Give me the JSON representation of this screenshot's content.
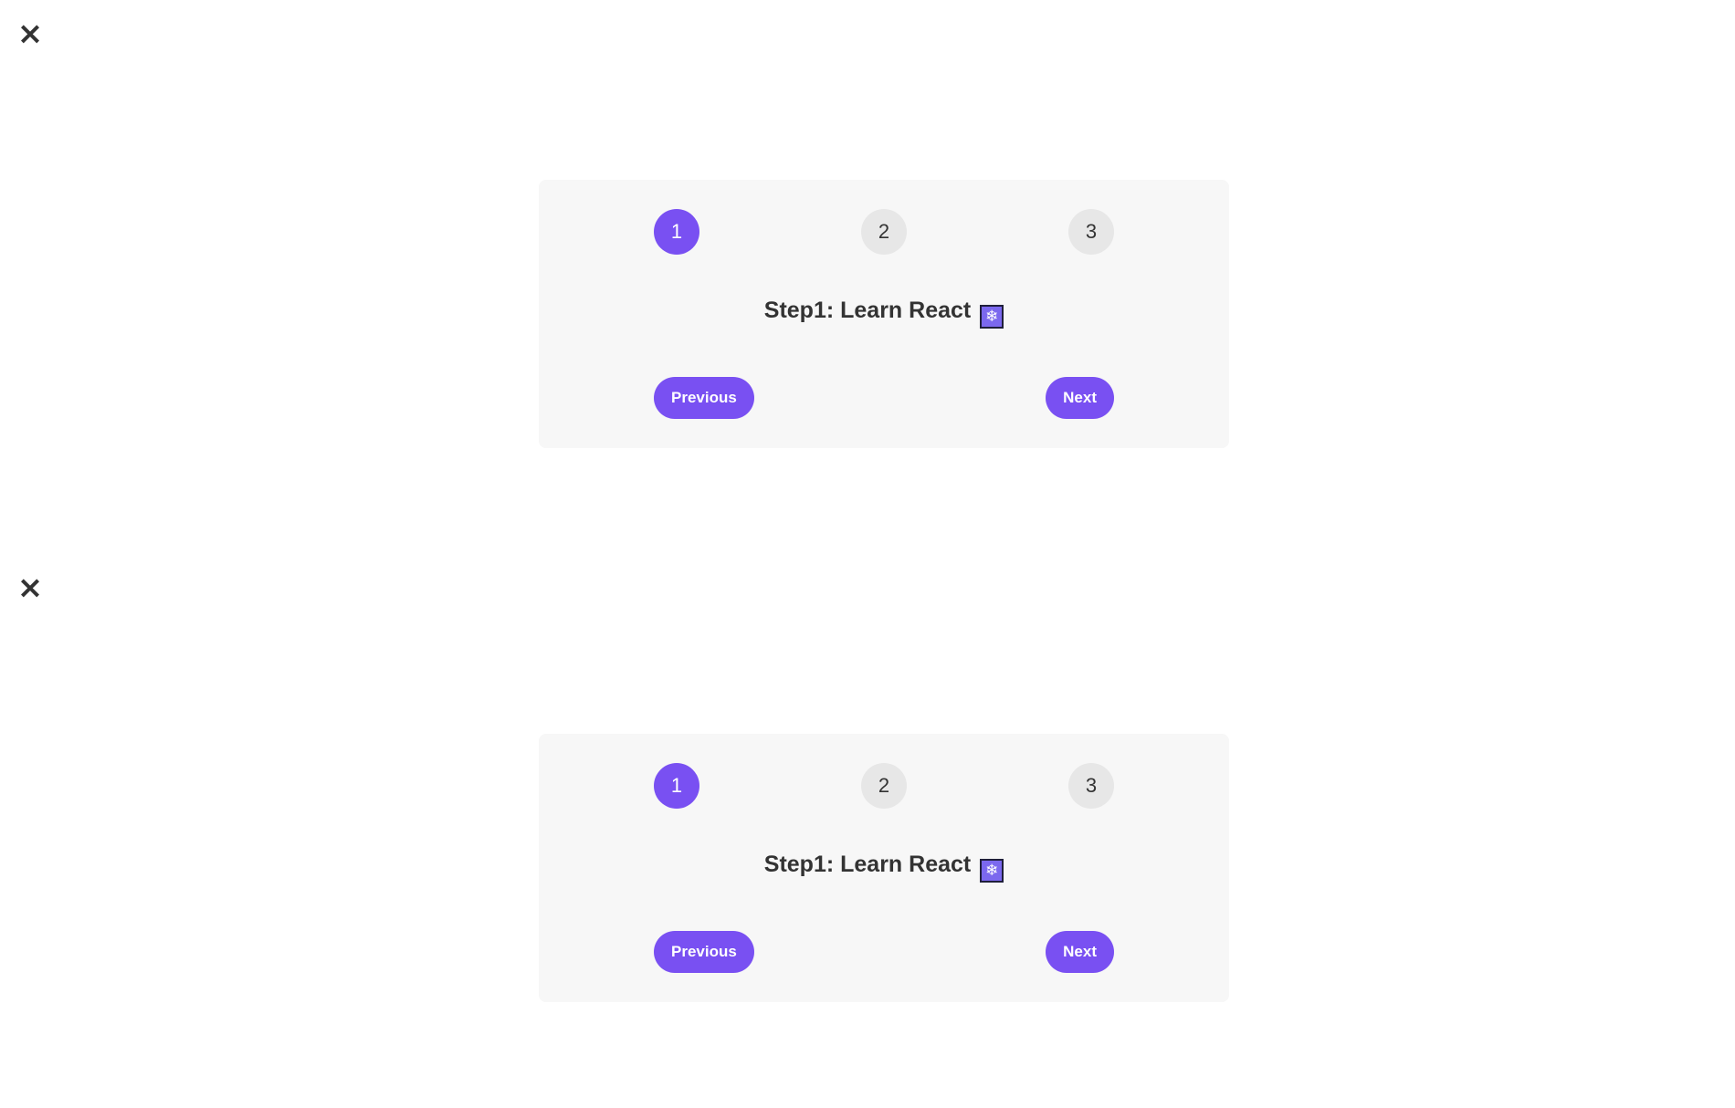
{
  "close_icon": "×",
  "steps": [
    {
      "number": "1",
      "active": true
    },
    {
      "number": "2",
      "active": false
    },
    {
      "number": "3",
      "active": false
    }
  ],
  "message": {
    "text": "Step1: Learn React",
    "emoji": "❄"
  },
  "buttons": {
    "previous_label": "Previous",
    "next_label": "Next"
  },
  "colors": {
    "accent": "#7950f2",
    "inactive_step": "#e7e7e7",
    "card_background": "#f7f7f7",
    "text": "#333333"
  }
}
